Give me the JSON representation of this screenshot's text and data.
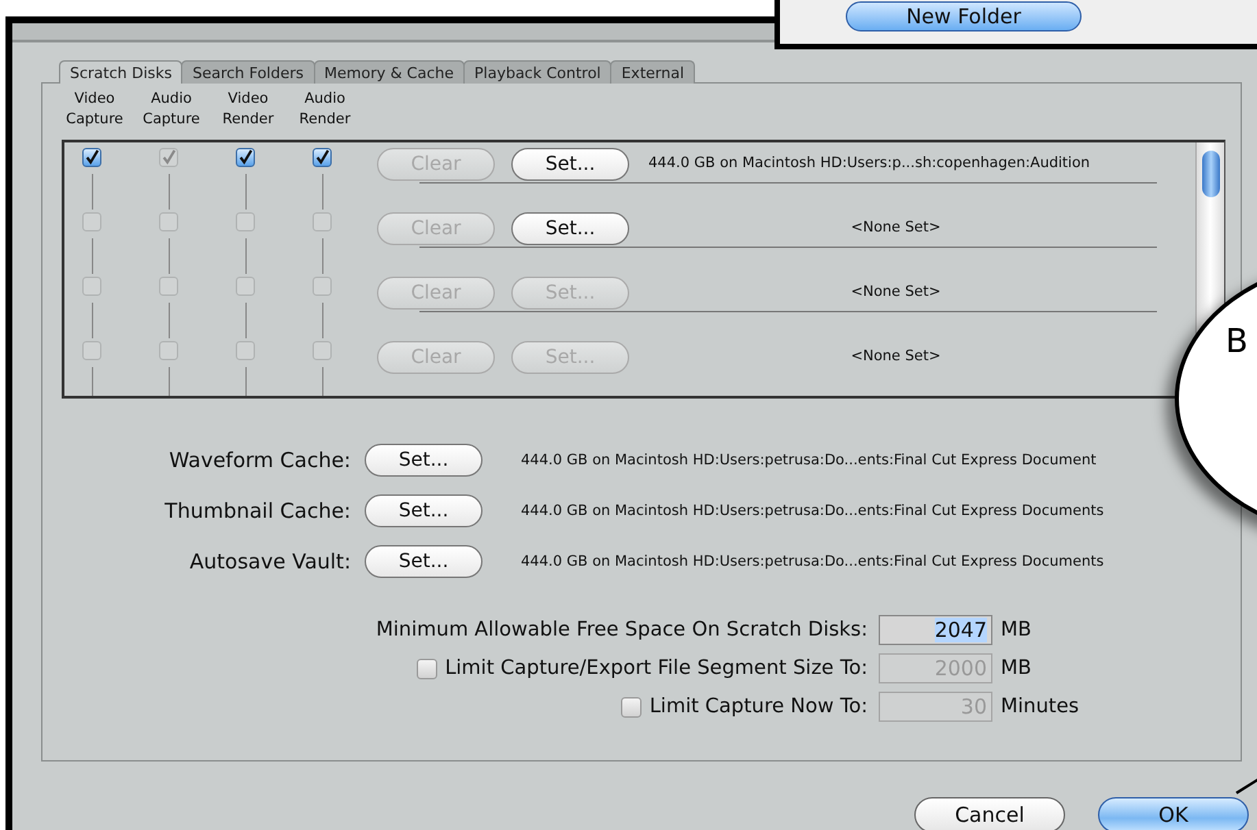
{
  "overlay_window": {
    "button": "New Folder"
  },
  "callout": {
    "text": "B"
  },
  "tabs": [
    {
      "label": "Scratch Disks",
      "selected": true
    },
    {
      "label": "Search Folders",
      "selected": false
    },
    {
      "label": "Memory & Cache",
      "selected": false
    },
    {
      "label": "Playback Control",
      "selected": false
    },
    {
      "label": "External",
      "selected": false
    }
  ],
  "scratch_columns": [
    "Video Capture",
    "Audio Capture",
    "Video Render",
    "Audio Render"
  ],
  "scratch_disks": [
    {
      "checks": [
        {
          "checked": true,
          "disabled": false
        },
        {
          "checked": true,
          "disabled": true
        },
        {
          "checked": true,
          "disabled": false
        },
        {
          "checked": true,
          "disabled": false
        }
      ],
      "clear": {
        "label": "Clear",
        "disabled": true
      },
      "set": {
        "label": "Set...",
        "disabled": false
      },
      "kind": "path",
      "location": "444.0 GB on  Macintosh HD:Users:p...sh:copenhagen:Audition"
    },
    {
      "checks": [
        {
          "checked": false,
          "disabled": true
        },
        {
          "checked": false,
          "disabled": true
        },
        {
          "checked": false,
          "disabled": true
        },
        {
          "checked": false,
          "disabled": true
        }
      ],
      "clear": {
        "label": "Clear",
        "disabled": true
      },
      "set": {
        "label": "Set...",
        "disabled": false
      },
      "kind": "none",
      "location": "<None Set>"
    },
    {
      "checks": [
        {
          "checked": false,
          "disabled": true
        },
        {
          "checked": false,
          "disabled": true
        },
        {
          "checked": false,
          "disabled": true
        },
        {
          "checked": false,
          "disabled": true
        }
      ],
      "clear": {
        "label": "Clear",
        "disabled": true
      },
      "set": {
        "label": "Set...",
        "disabled": true
      },
      "kind": "none",
      "location": "<None Set>"
    },
    {
      "checks": [
        {
          "checked": false,
          "disabled": true
        },
        {
          "checked": false,
          "disabled": true
        },
        {
          "checked": false,
          "disabled": true
        },
        {
          "checked": false,
          "disabled": true
        }
      ],
      "clear": {
        "label": "Clear",
        "disabled": true
      },
      "set": {
        "label": "Set...",
        "disabled": true
      },
      "kind": "none",
      "location": "<None Set>"
    }
  ],
  "caches": [
    {
      "label": "Waveform Cache:",
      "button": "Set...",
      "location": "444.0 GB on  Macintosh HD:Users:petrusa:Do...ents:Final Cut Express Document"
    },
    {
      "label": "Thumbnail Cache:",
      "button": "Set...",
      "location": "444.0 GB on  Macintosh HD:Users:petrusa:Do...ents:Final Cut Express Documents"
    },
    {
      "label": "Autosave Vault:",
      "button": "Set...",
      "location": "444.0 GB on  Macintosh HD:Users:petrusa:Do...ents:Final Cut Express Documents"
    }
  ],
  "limits": [
    {
      "kind": "plain",
      "label": "Minimum Allowable Free Space On Scratch Disks:",
      "value": "2047",
      "unit": "MB",
      "disabled": false,
      "selected": true
    },
    {
      "kind": "checkbox",
      "checked": false,
      "label": "Limit Capture/Export File Segment Size To:",
      "value": "2000",
      "unit": "MB",
      "disabled": true,
      "selected": false
    },
    {
      "kind": "checkbox",
      "checked": false,
      "label": "Limit Capture Now To:",
      "value": "30",
      "unit": "Minutes",
      "disabled": true,
      "selected": false
    }
  ],
  "buttons": [
    {
      "label": "Cancel",
      "default": false
    },
    {
      "label": "OK",
      "default": true
    }
  ]
}
